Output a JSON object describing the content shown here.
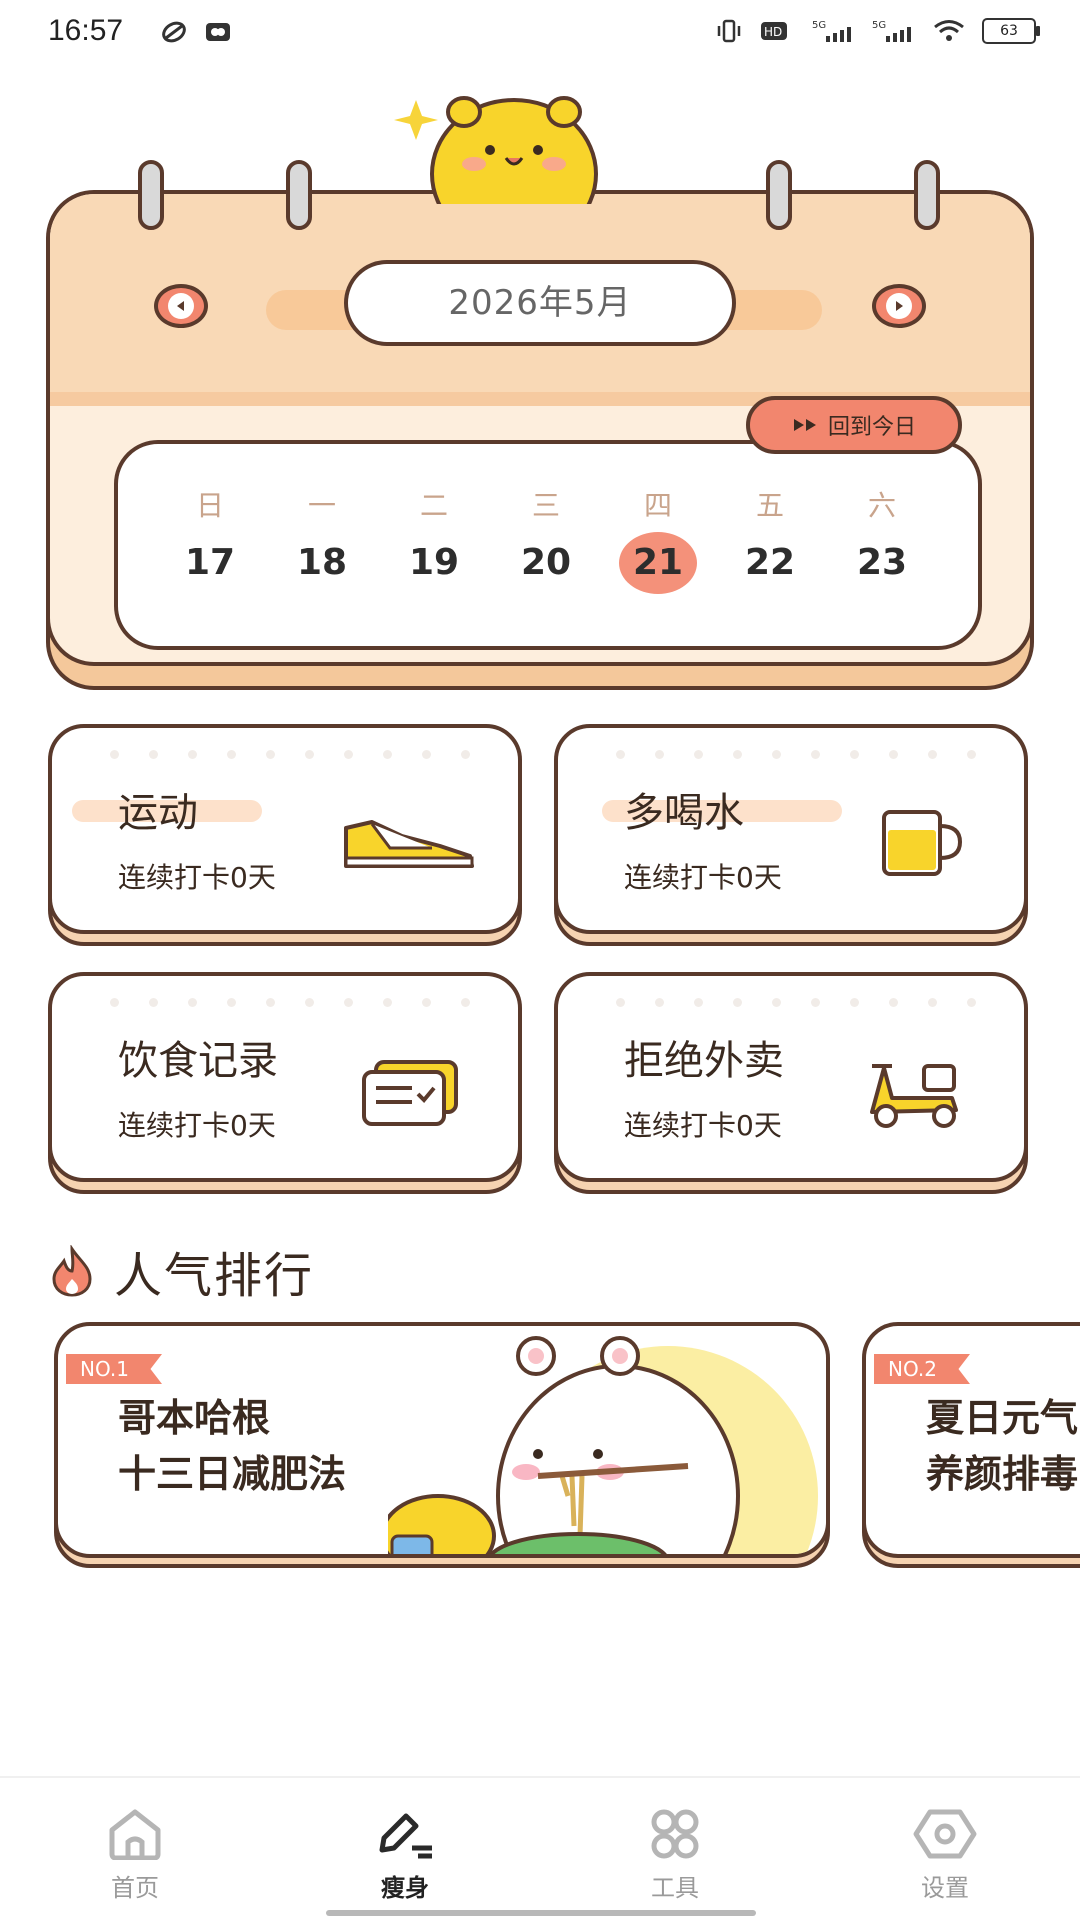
{
  "status_bar": {
    "time": "16:57",
    "battery": "63"
  },
  "calendar": {
    "month": "2026年5月",
    "back_today": "回到今日",
    "weekdays": [
      "日",
      "一",
      "二",
      "三",
      "四",
      "五",
      "六"
    ],
    "dates": [
      "17",
      "18",
      "19",
      "20",
      "21",
      "22",
      "23"
    ],
    "selected_date": "21"
  },
  "habits": [
    {
      "title": "运动",
      "streak": "连续打卡0天",
      "icon": "sneaker-icon"
    },
    {
      "title": "多喝水",
      "streak": "连续打卡0天",
      "icon": "cup-icon"
    },
    {
      "title": "饮食记录",
      "streak": "连续打卡0天",
      "icon": "card-check-icon"
    },
    {
      "title": "拒绝外卖",
      "streak": "连续打卡0天",
      "icon": "scooter-icon"
    }
  ],
  "ranking": {
    "title": "人气排行",
    "items": [
      {
        "badge": "NO.1",
        "line1": "哥本哈根",
        "line2": "十三日减肥法"
      },
      {
        "badge": "NO.2",
        "line1": "夏日元气",
        "line2": "养颜排毒"
      }
    ]
  },
  "bottom_nav": [
    {
      "label": "首页",
      "icon": "home-icon"
    },
    {
      "label": "瘦身",
      "icon": "pen-icon",
      "active": true
    },
    {
      "label": "工具",
      "icon": "grid-icon"
    },
    {
      "label": "设置",
      "icon": "hexagon-icon"
    }
  ],
  "colors": {
    "accent": "#f2866e",
    "outline": "#5a3a2c",
    "calendar_head": "#f9d9b6",
    "card_shadow": "#f6d3b1"
  }
}
